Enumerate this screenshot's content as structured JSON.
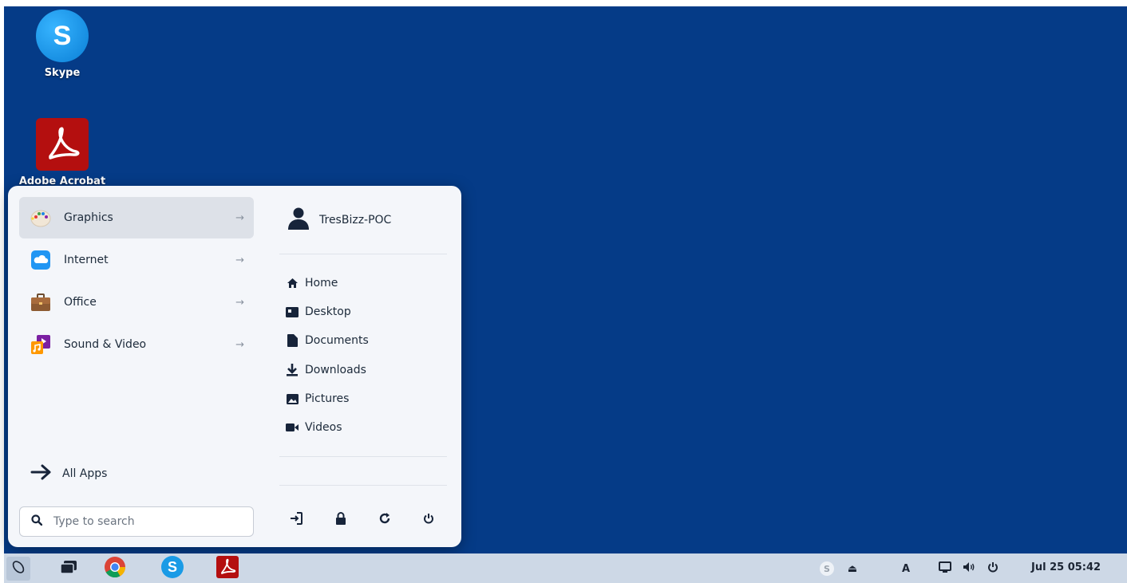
{
  "desktop": {
    "background": "#053b87",
    "icons": [
      {
        "label": "Skype",
        "icon": "skype-icon"
      },
      {
        "label": "Adobe Acrobat",
        "icon": "adobe-acrobat-icon"
      }
    ]
  },
  "start_menu": {
    "categories": [
      {
        "label": "Graphics",
        "icon": "palette-icon",
        "arrow": "→",
        "active": true
      },
      {
        "label": "Internet",
        "icon": "cloud-icon",
        "arrow": "→"
      },
      {
        "label": "Office",
        "icon": "briefcase-icon",
        "arrow": "→"
      },
      {
        "label": "Sound & Video",
        "icon": "music-video-icon",
        "arrow": "→"
      }
    ],
    "all_apps_label": "All Apps",
    "search": {
      "placeholder": "Type to search",
      "value": ""
    },
    "user": {
      "name": "TresBizz-POC",
      "icon": "user-icon"
    },
    "places": [
      {
        "label": "Home",
        "icon": "home-icon"
      },
      {
        "label": "Desktop",
        "icon": "desktop-icon"
      },
      {
        "label": "Documents",
        "icon": "document-icon"
      },
      {
        "label": "Downloads",
        "icon": "download-icon"
      },
      {
        "label": "Pictures",
        "icon": "picture-icon"
      },
      {
        "label": "Videos",
        "icon": "video-icon"
      }
    ],
    "session_actions": [
      "logout-icon",
      "lock-icon",
      "restart-icon",
      "power-icon"
    ]
  },
  "taskbar": {
    "background": "#cdd8e6",
    "apps": [
      "menu-icon",
      "window-switcher-icon",
      "chrome-icon",
      "skype-icon",
      "adobe-acrobat-icon"
    ],
    "tray": {
      "skype_icon": "S",
      "eject_icon": "⏏",
      "keyboard_label": "A",
      "icons": [
        "display-icon",
        "volume-icon",
        "power-icon"
      ]
    },
    "clock": "Jul 25  05:42"
  }
}
